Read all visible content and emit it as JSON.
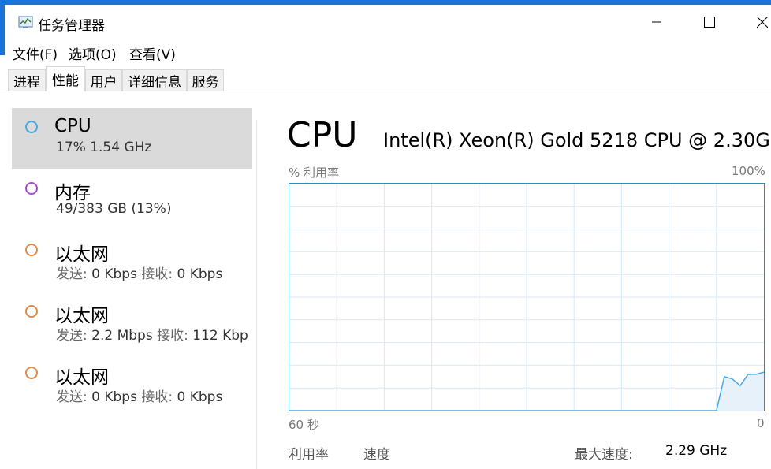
{
  "window": {
    "title": "任务管理器"
  },
  "menu": [
    "文件(F)",
    "选项(O)",
    "查看(V)"
  ],
  "tabs": [
    "进程",
    "性能",
    "用户",
    "详细信息",
    "服务"
  ],
  "resources": [
    {
      "name": "CPU",
      "detail": "17%  1.54 GHz",
      "color": "#4aa8e0"
    },
    {
      "name": "内存",
      "detail": "49/383 GB (13%)",
      "color": "#a64dc4"
    },
    {
      "name": "以太网",
      "send_label": "发送:",
      "send": "0 Kbps",
      "recv_label": "接收:",
      "recv": "0 Kbps",
      "color": "#d98c4c"
    },
    {
      "name": "以太网",
      "send_label": "发送:",
      "send": "2.2 Mbps",
      "recv_label": "接收:",
      "recv": "112 Kbp",
      "color": "#d98c4c"
    },
    {
      "name": "以太网",
      "send_label": "发送:",
      "send": "0 Kbps",
      "recv_label": "接收:",
      "recv": "0 Kbps",
      "color": "#d98c4c"
    }
  ],
  "main": {
    "title": "CPU",
    "model": "Intel(R) Xeon(R) Gold 5218 CPU @ 2.30G...",
    "y_axis_label": "% 利用率",
    "y_axis_max": "100%",
    "x_axis_left": "60 秒",
    "x_axis_right": "0"
  },
  "stats": {
    "utilization_label": "利用率",
    "speed_label": "速度",
    "max_speed_label": "最大速度:",
    "max_speed_value": "2.29 GHz"
  },
  "chart_data": {
    "type": "area",
    "x": [
      60,
      54,
      48,
      42,
      36,
      30,
      24,
      18,
      12,
      6,
      5,
      4,
      3,
      2,
      1,
      0
    ],
    "values": [
      0,
      0,
      0,
      0,
      0,
      0,
      0,
      0,
      0,
      0,
      15,
      14,
      11,
      16,
      16,
      17
    ],
    "ylim": [
      0,
      100
    ],
    "grid": true,
    "colors": {
      "line": "#4aa8e0",
      "fill": "#e6f1f9",
      "grid": "#d9eaf5"
    }
  }
}
